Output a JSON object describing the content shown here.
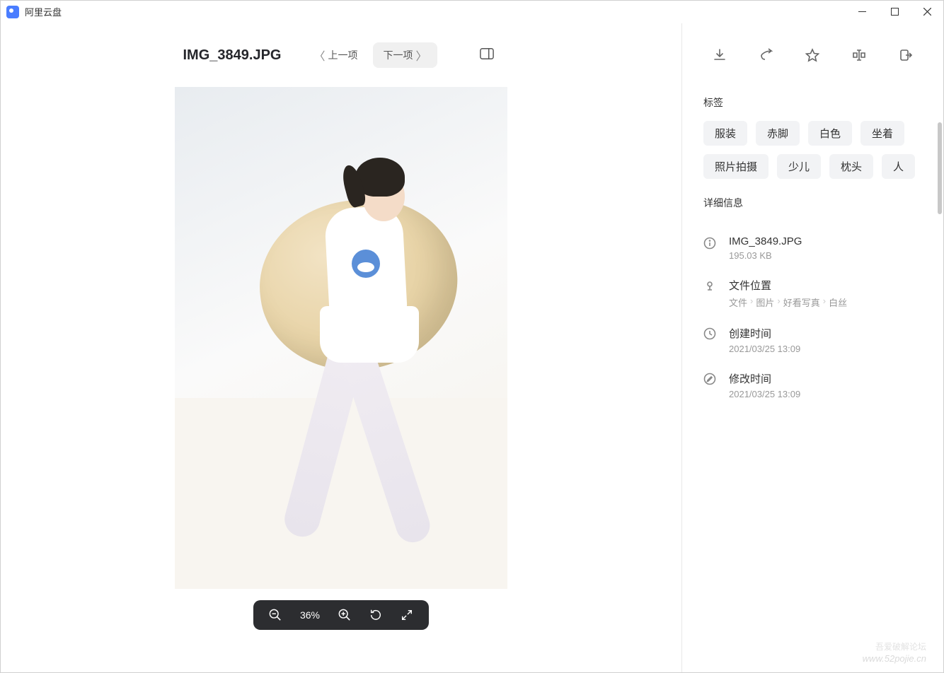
{
  "window": {
    "title": "阿里云盘"
  },
  "header": {
    "filename": "IMG_3849.JPG",
    "prev_label": "上一项",
    "next_label": "下一项"
  },
  "zoom": {
    "percent": "36%"
  },
  "sidebar": {
    "tags_title": "标签",
    "tags": [
      "服装",
      "赤脚",
      "白色",
      "坐着",
      "照片拍摄",
      "少儿",
      "枕头",
      "人"
    ],
    "details_title": "详细信息",
    "file": {
      "name": "IMG_3849.JPG",
      "size": "195.03 KB"
    },
    "location": {
      "label": "文件位置",
      "path": [
        "文件",
        "图片",
        "好看写真",
        "白丝"
      ]
    },
    "created": {
      "label": "创建时间",
      "value": "2021/03/25 13:09"
    },
    "modified": {
      "label": "修改时间",
      "value": "2021/03/25 13:09"
    }
  },
  "watermark": {
    "line1": "吾爱破解论坛",
    "line2": "www.52pojie.cn"
  }
}
